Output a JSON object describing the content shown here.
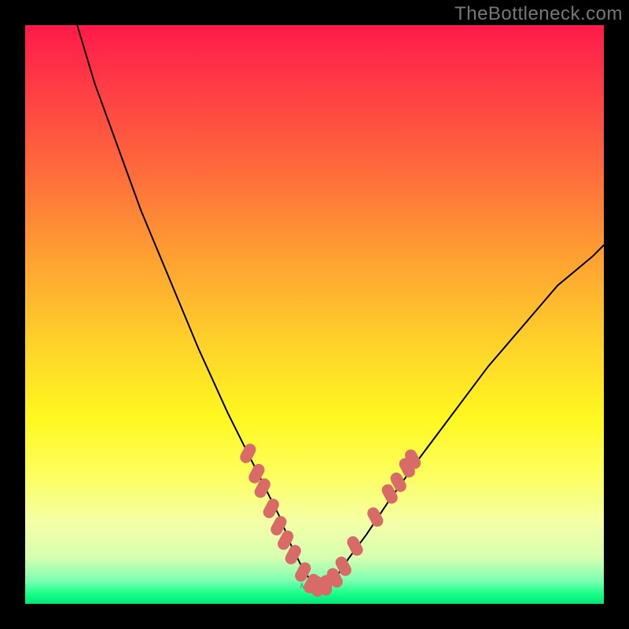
{
  "watermark": {
    "text": "TheBottleneck.com"
  },
  "colors": {
    "bead": "#d86a68",
    "curve": "#000000",
    "gradient_top": "#ff1a4a",
    "gradient_bottom": "#00e676"
  },
  "chart_data": {
    "type": "line",
    "title": "",
    "xlabel": "",
    "ylabel": "",
    "xlim": [
      0,
      100
    ],
    "ylim": [
      0,
      100
    ],
    "grid": false,
    "legend": false,
    "note": "Bottleneck-style V-curve on a red→green vertical gradient. y=0 at bottom (green), y=100 at top (red). Minimum of the curve sits near x≈50.",
    "series": [
      {
        "name": "curve",
        "x": [
          9,
          12,
          16,
          20,
          25,
          30,
          35,
          38,
          41,
          44,
          46,
          48,
          50,
          52,
          54,
          56,
          59,
          63,
          68,
          74,
          80,
          86,
          92,
          98,
          100
        ],
        "y": [
          100,
          90,
          79,
          68,
          56,
          44,
          33,
          27,
          21,
          15,
          10,
          6,
          3,
          3,
          5,
          8,
          12,
          18,
          25,
          33,
          41,
          48,
          55,
          60,
          62
        ]
      }
    ],
    "beads": {
      "name": "marker-beads",
      "note": "Salmon capsule markers clustered on lower flanks of the V.",
      "points": [
        {
          "x": 38.5,
          "y": 26
        },
        {
          "x": 40.0,
          "y": 22.5
        },
        {
          "x": 41.0,
          "y": 20
        },
        {
          "x": 42.5,
          "y": 16.5
        },
        {
          "x": 43.8,
          "y": 13.5
        },
        {
          "x": 45.0,
          "y": 11
        },
        {
          "x": 46.3,
          "y": 8.5
        },
        {
          "x": 48.0,
          "y": 5.5
        },
        {
          "x": 49.5,
          "y": 3.5
        },
        {
          "x": 50.5,
          "y": 3
        },
        {
          "x": 52.0,
          "y": 3.2
        },
        {
          "x": 53.5,
          "y": 4.5
        },
        {
          "x": 55.0,
          "y": 6.5
        },
        {
          "x": 57.0,
          "y": 10
        },
        {
          "x": 60.5,
          "y": 15
        },
        {
          "x": 63.0,
          "y": 19
        },
        {
          "x": 64.5,
          "y": 21
        },
        {
          "x": 66.0,
          "y": 23.5
        },
        {
          "x": 67.0,
          "y": 25
        }
      ]
    }
  }
}
